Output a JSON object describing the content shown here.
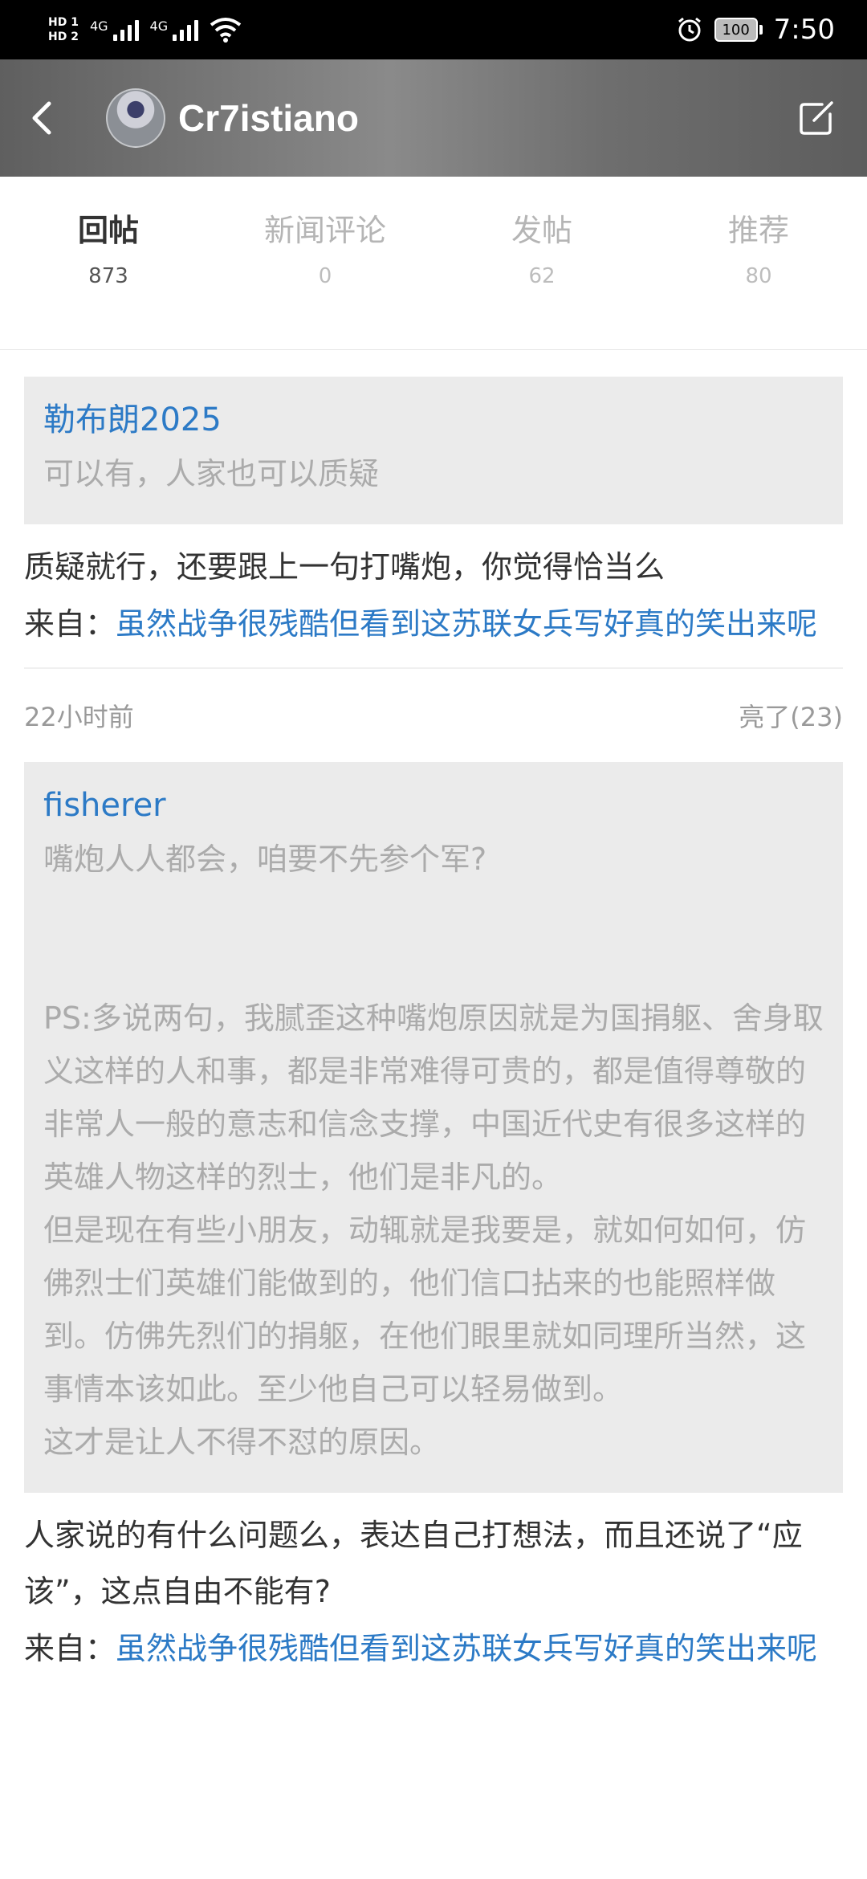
{
  "status_bar": {
    "hd1": "HD 1",
    "hd2": "HD 2",
    "sig1": "4G",
    "sig2": "4G",
    "battery": "100",
    "time": "7:50"
  },
  "header": {
    "username": "Cr7istiano"
  },
  "tabs": [
    {
      "label": "回帖",
      "count": "873",
      "active": true
    },
    {
      "label": "新闻评论",
      "count": "0"
    },
    {
      "label": "发帖",
      "count": "62"
    },
    {
      "label": "推荐",
      "count": "80"
    }
  ],
  "posts": [
    {
      "quote_user": "勒布朗2025",
      "quote_text": "可以有，人家也可以质疑",
      "reply": "质疑就行，还要跟上一句打嘴炮，你觉得恰当么",
      "from_label": "来自：",
      "from_link": "虽然战争很残酷但看到这苏联女兵写好真的笑出来呢"
    },
    {
      "time": "22小时前",
      "likes": "亮了(23)",
      "quote_user": "fisherer",
      "quote_text": "嘴炮人人都会，咱要不先参个军?\n\n\nPS:多说两句，我腻歪这种嘴炮原因就是为国捐躯、舍身取义这样的人和事，都是非常难得可贵的，都是值得尊敬的非常人一般的意志和信念支撑，中国近代史有很多这样的英雄人物这样的烈士，他们是非凡的。\n但是现在有些小朋友，动辄就是我要是，就如何如何，仿佛烈士们英雄们能做到的，他们信口拈来的也能照样做到。仿佛先烈们的捐躯，在他们眼里就如同理所当然，这事情本该如此。至少他自己可以轻易做到。\n这才是让人不得不怼的原因。",
      "reply": "人家说的有什么问题么，表达自己打想法，而且还说了“应该”，这点自由不能有?",
      "from_label": "来自：",
      "from_link": "虽然战争很残酷但看到这苏联女兵写好真的笑出来呢"
    }
  ],
  "colors": {
    "link": "#2c7ac6",
    "quote_bg": "#ebebeb",
    "header_bg": "#777777"
  }
}
